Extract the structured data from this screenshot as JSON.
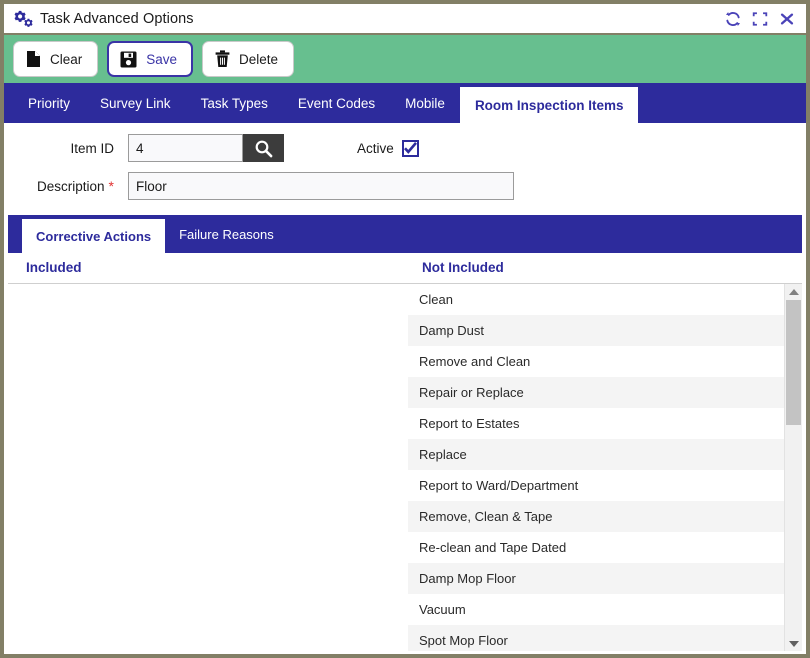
{
  "window": {
    "title": "Task Advanced Options",
    "icon": "gears-icon",
    "controls": [
      {
        "name": "refresh-icon",
        "label": "Refresh"
      },
      {
        "name": "maximize-icon",
        "label": "Maximize"
      },
      {
        "name": "close-icon",
        "label": "Close"
      }
    ]
  },
  "toolbar": {
    "clear_label": "Clear",
    "save_label": "Save",
    "delete_label": "Delete",
    "background_color": "#67bf8f",
    "focused_button": "Save",
    "focus_color": "#3a34a6"
  },
  "tabs": {
    "items": [
      {
        "label": "Priority",
        "active": false
      },
      {
        "label": "Survey Link",
        "active": false
      },
      {
        "label": "Task Types",
        "active": false
      },
      {
        "label": "Event Codes",
        "active": false
      },
      {
        "label": "Mobile",
        "active": false
      },
      {
        "label": "Room Inspection Items",
        "active": true
      }
    ],
    "bar_color": "#2d2b9c",
    "active_text_color": "#2d2b9c"
  },
  "form": {
    "item_id_label": "Item ID",
    "item_id_value": "4",
    "item_id_placeholder": "",
    "search_icon": "magnifier-icon",
    "active_label": "Active",
    "active_checked": true,
    "description_label": "Description",
    "description_required_marker": "*",
    "description_value": "Floor",
    "description_placeholder": "",
    "required_color": "#e03131"
  },
  "subtabs": {
    "items": [
      {
        "label": "Corrective Actions",
        "active": true
      },
      {
        "label": "Failure Reasons",
        "active": false
      }
    ]
  },
  "columns": {
    "included_header": "Included",
    "not_included_header": "Not Included"
  },
  "lists": {
    "included": [],
    "not_included": [
      "Clean",
      "Damp Dust",
      "Remove and Clean",
      "Repair or Replace",
      "Report to Estates",
      "Replace",
      "Report to Ward/Department",
      "Remove, Clean & Tape",
      "Re-clean and Tape Dated",
      "Damp Mop Floor",
      "Vacuum",
      "Spot Mop Floor"
    ]
  },
  "scrollbar": {
    "up_arrow": "caret-up-icon",
    "down_arrow": "caret-down-icon",
    "thumb_position_percent": 0
  }
}
